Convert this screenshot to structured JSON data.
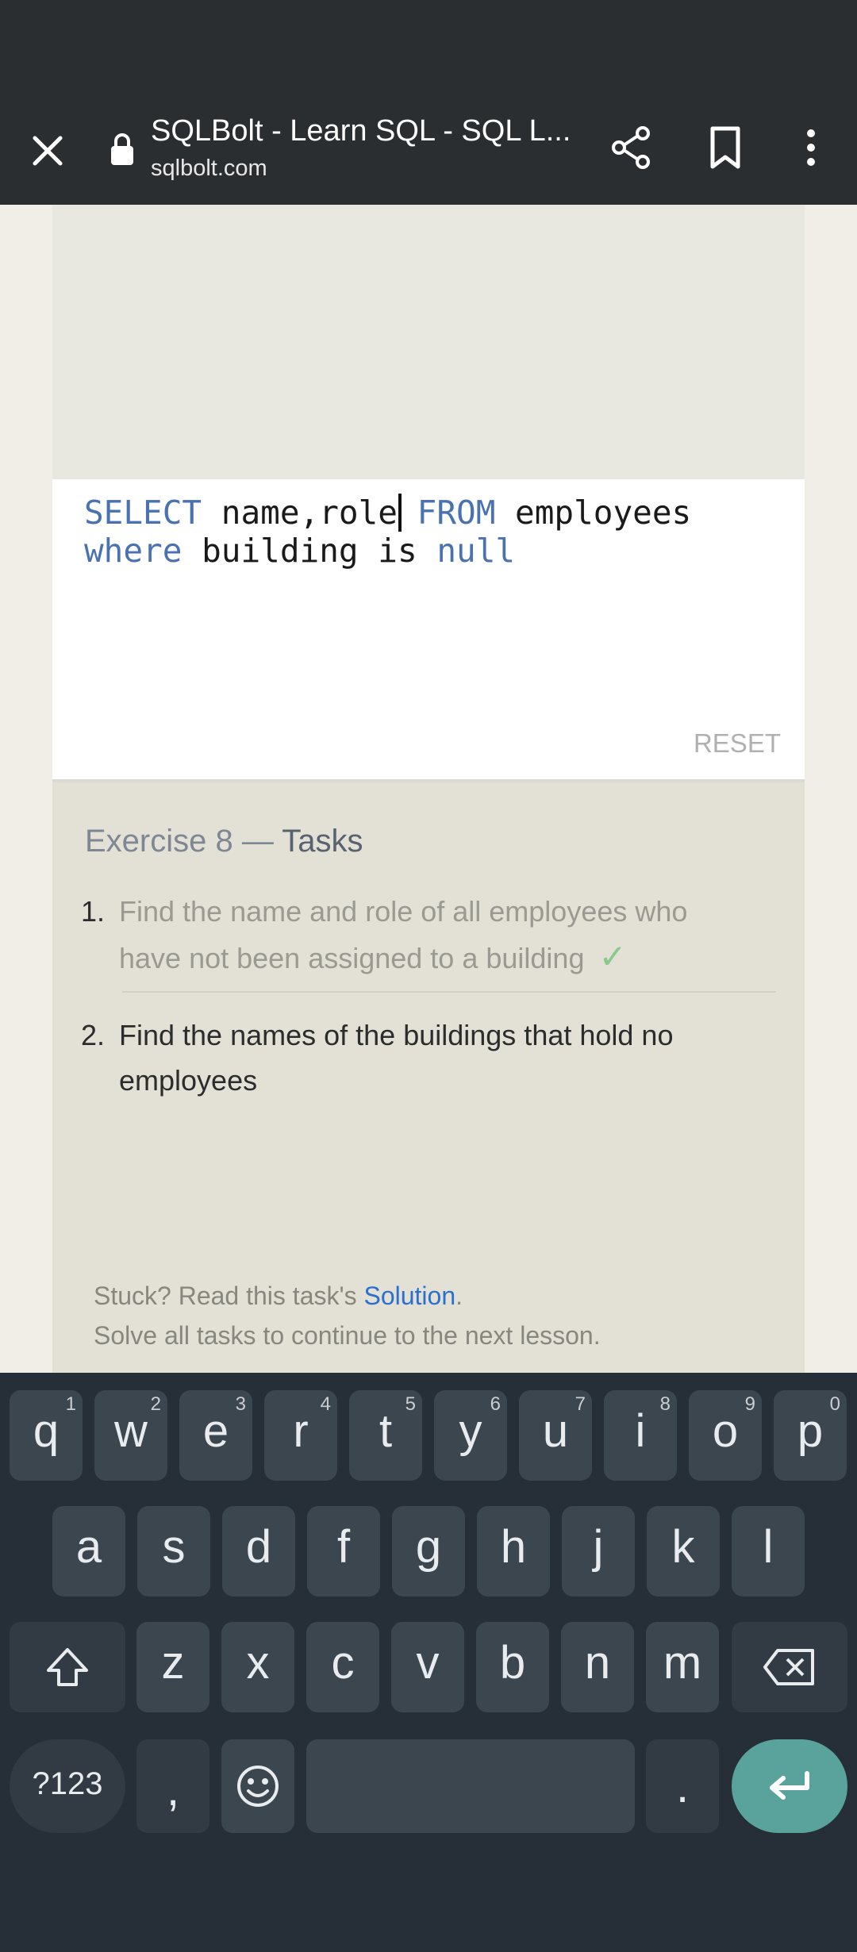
{
  "browser": {
    "title": "SQLBolt - Learn SQL - SQL L...",
    "url": "sqlbolt.com"
  },
  "editor": {
    "line1": [
      {
        "text": "SELECT",
        "kw": true
      },
      {
        "text": " name,role",
        "kw": false
      },
      {
        "text": " FROM",
        "kw": true
      },
      {
        "text": " employees",
        "kw": false
      }
    ],
    "line2": [
      {
        "text": "where",
        "kw": true
      },
      {
        "text": " building is ",
        "kw": false
      },
      {
        "text": "null",
        "kw": true
      }
    ],
    "reset_label": "RESET"
  },
  "tasks": {
    "exercise_label": "Exercise 8",
    "separator": " — ",
    "tasks_label": "Tasks",
    "items": [
      {
        "num": "1.",
        "line1": "Find the name and role of all employees who",
        "line2": "have not been assigned to a building",
        "done": true,
        "check": "✓"
      },
      {
        "num": "2.",
        "line1": "Find the names of the buildings that hold no",
        "line2": "employees",
        "done": false
      }
    ],
    "stuck_prefix": "Stuck? Read this task's ",
    "solution_link": "Solution",
    "stuck_suffix": ".",
    "solve_note": "Solve all tasks to continue to the next lesson."
  },
  "keyboard": {
    "row1": [
      {
        "ch": "q",
        "hint": "1"
      },
      {
        "ch": "w",
        "hint": "2"
      },
      {
        "ch": "e",
        "hint": "3"
      },
      {
        "ch": "r",
        "hint": "4"
      },
      {
        "ch": "t",
        "hint": "5"
      },
      {
        "ch": "y",
        "hint": "6"
      },
      {
        "ch": "u",
        "hint": "7"
      },
      {
        "ch": "i",
        "hint": "8"
      },
      {
        "ch": "o",
        "hint": "9"
      },
      {
        "ch": "p",
        "hint": "0"
      }
    ],
    "row2": [
      "a",
      "s",
      "d",
      "f",
      "g",
      "h",
      "j",
      "k",
      "l"
    ],
    "row3": [
      "z",
      "x",
      "c",
      "v",
      "b",
      "n",
      "m"
    ],
    "symbols_label": "?123",
    "comma": ",",
    "period": ".",
    "icons": {
      "shift": "shift-icon",
      "backspace": "backspace-icon",
      "emoji": "emoji-icon",
      "enter": "enter-icon"
    }
  }
}
